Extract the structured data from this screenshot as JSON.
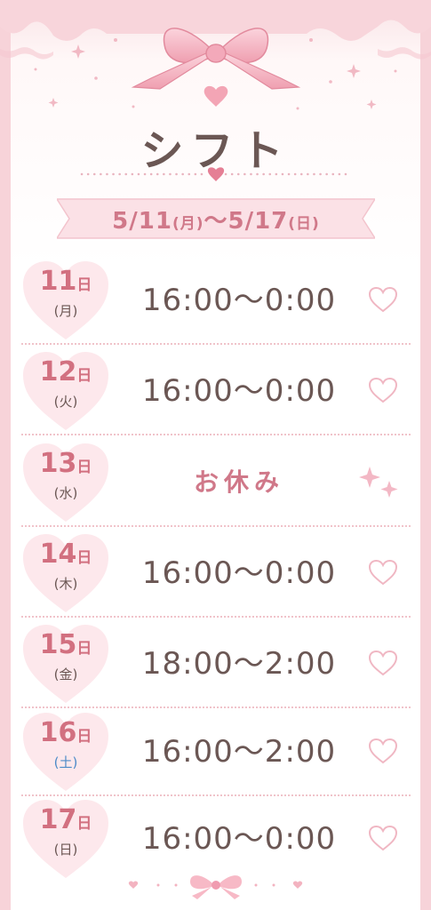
{
  "header": {
    "title": "シフト"
  },
  "week_range": {
    "start": "5/11",
    "start_day": "(月)",
    "separator": "〜",
    "end": "5/17",
    "end_day": "(日)"
  },
  "colors": {
    "accent_pink": "#d07889",
    "text_brown": "#6b5754",
    "saturday_blue": "#4d8bc8",
    "light_pink": "#fbe1e6"
  },
  "decor": {
    "top_icon": "ribbon-bow-icon",
    "small_icon": "heart-icon",
    "row_icon": "heart-outline-icon",
    "day_off_icon": "sparkle-icon",
    "bottom_icon": "small-ribbon-icon"
  },
  "day_suffix": "日",
  "shifts": [
    {
      "day": "11",
      "weekday": "(月)",
      "time": "16:00〜0:00",
      "off": false
    },
    {
      "day": "12",
      "weekday": "(火)",
      "time": "16:00〜0:00",
      "off": false
    },
    {
      "day": "13",
      "weekday": "(水)",
      "time": "お休み",
      "off": true
    },
    {
      "day": "14",
      "weekday": "(木)",
      "time": "16:00〜0:00",
      "off": false
    },
    {
      "day": "15",
      "weekday": "(金)",
      "time": "18:00〜2:00",
      "off": false
    },
    {
      "day": "16",
      "weekday": "(土)",
      "time": "16:00〜2:00",
      "off": false
    },
    {
      "day": "17",
      "weekday": "(日)",
      "time": "16:00〜0:00",
      "off": false
    }
  ]
}
